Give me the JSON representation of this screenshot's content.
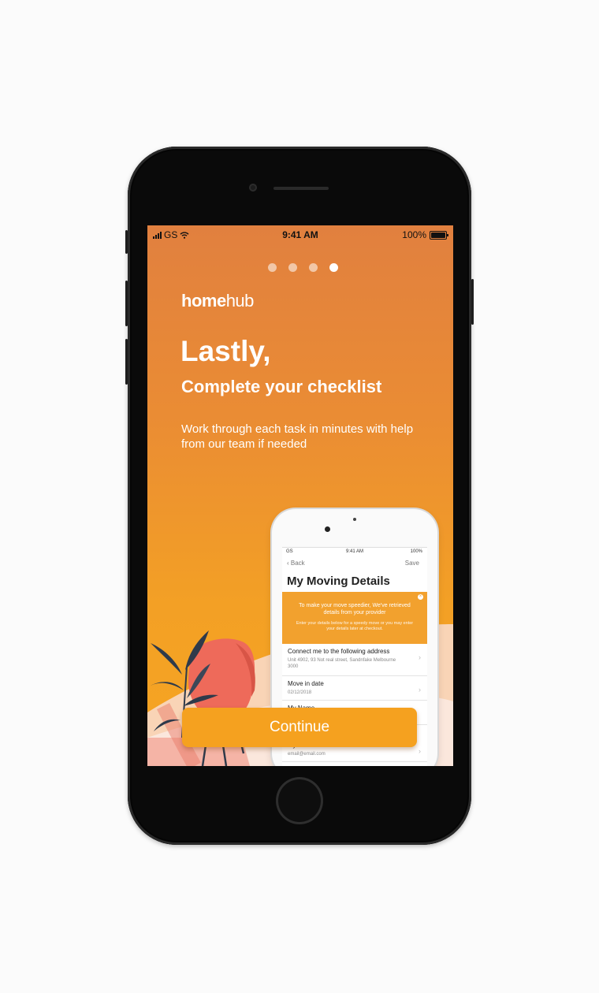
{
  "status_bar": {
    "carrier": "GS",
    "time": "9:41 AM",
    "battery": "100%"
  },
  "pager": {
    "total": 4,
    "active_index": 3
  },
  "brand": {
    "logo_bold": "home",
    "logo_light": "hub"
  },
  "content": {
    "title": "Lastly,",
    "subtitle": "Complete your checklist",
    "description": "Work through each task in minutes with help from our team if needed"
  },
  "preview": {
    "status": {
      "carrier": "GS",
      "time": "9:41 AM",
      "battery": "100%"
    },
    "nav": {
      "back": "Back",
      "save": "Save"
    },
    "title": "My Moving Details",
    "banner": {
      "headline": "To make your move speedier, We've retrieved details from your provider",
      "body": "Enter your details below for a speedy move or you may enter your details later at checkout."
    },
    "rows": [
      {
        "label": "Connect me to the following address",
        "value": "Unit 4902, 93 Not real street, Sandnfake Melbourne 3000"
      },
      {
        "label": "Move in date",
        "value": "02/12/2018"
      },
      {
        "label": "My Name",
        "value": ""
      },
      {
        "label": "My Email",
        "value": "email@email.com"
      }
    ]
  },
  "actions": {
    "continue_label": "Continue"
  },
  "colors": {
    "accent": "#f5a11f",
    "gradient_top": "#e1803f",
    "gradient_bottom": "#f6a522"
  },
  "icons": [
    "signal-icon",
    "wifi-icon",
    "battery-icon",
    "back-chevron-icon",
    "close-icon",
    "chevron-right-icon",
    "plant-illustration"
  ]
}
